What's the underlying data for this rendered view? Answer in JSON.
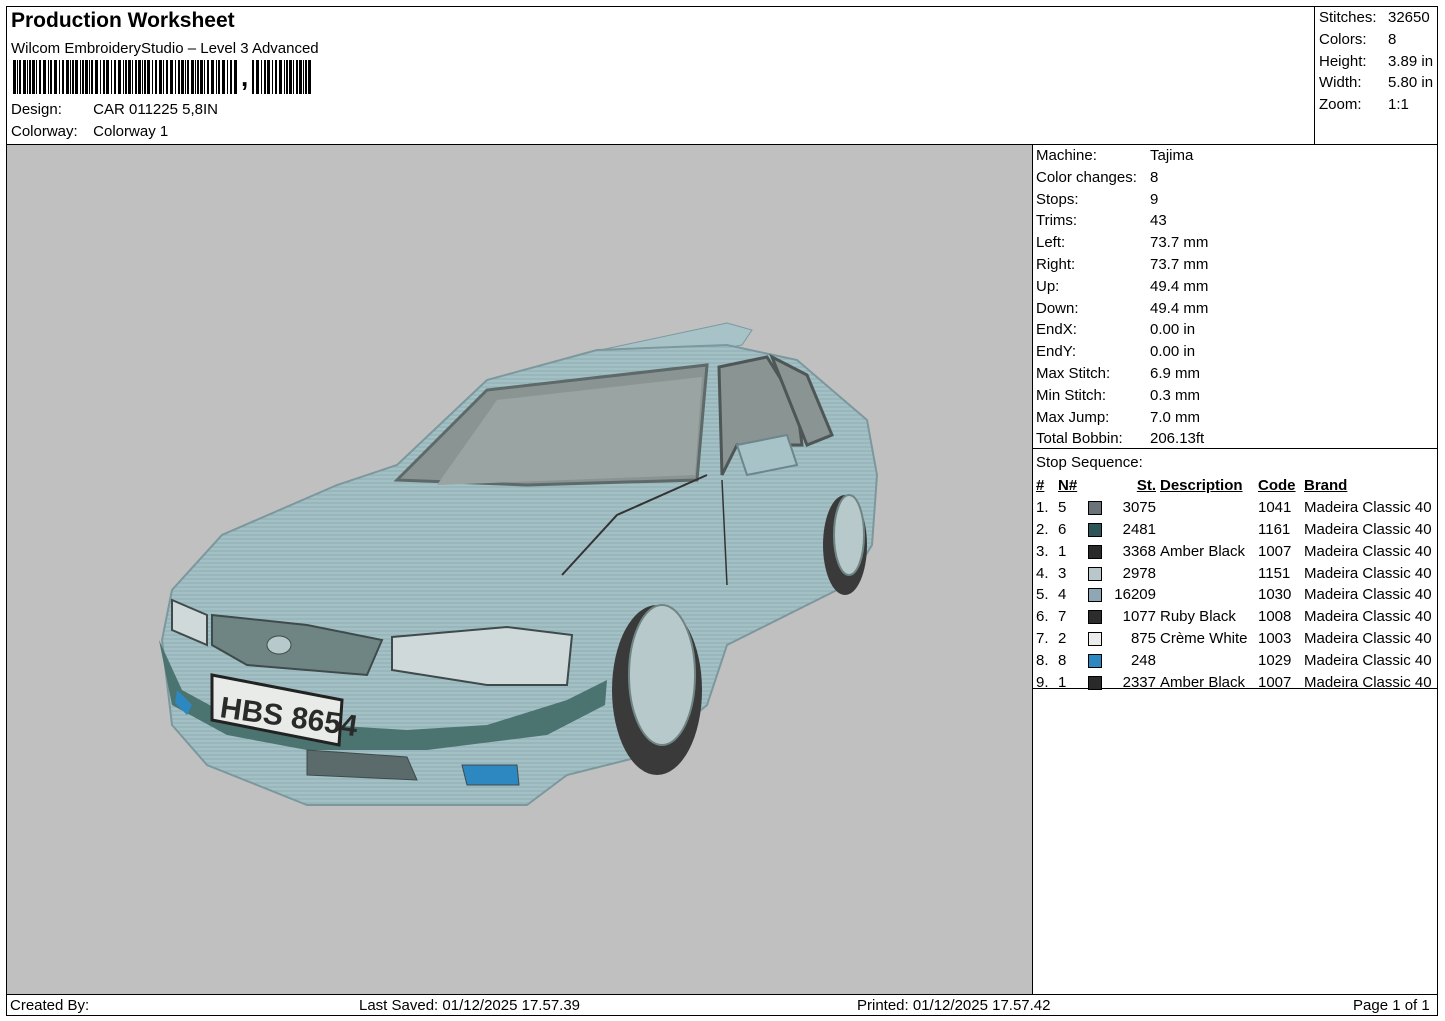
{
  "header": {
    "title": "Production Worksheet",
    "subtitle": "Wilcom EmbroideryStudio – Level 3 Advanced",
    "barcode_suffix": ",",
    "design_label": "Design:",
    "design_value": "CAR 011225 5,8IN",
    "colorway_label": "Colorway:",
    "colorway_value": "Colorway 1"
  },
  "summary": [
    {
      "label": "Stitches:",
      "value": "32650"
    },
    {
      "label": "Colors:",
      "value": "8"
    },
    {
      "label": "Height:",
      "value": "3.89 in"
    },
    {
      "label": "Width:",
      "value": "5.80 in"
    },
    {
      "label": "Zoom:",
      "value": "1:1"
    }
  ],
  "machine_info": [
    {
      "label": "Machine:",
      "value": "Tajima"
    },
    {
      "label": "Color changes:",
      "value": "8"
    },
    {
      "label": "Stops:",
      "value": "9"
    },
    {
      "label": "Trims:",
      "value": "43"
    },
    {
      "label": "Left:",
      "value": "73.7 mm"
    },
    {
      "label": "Right:",
      "value": "73.7 mm"
    },
    {
      "label": "Up:",
      "value": "49.4 mm"
    },
    {
      "label": "Down:",
      "value": "49.4 mm"
    },
    {
      "label": "EndX:",
      "value": "0.00 in"
    },
    {
      "label": "EndY:",
      "value": "0.00 in"
    },
    {
      "label": "Max Stitch:",
      "value": "6.9 mm"
    },
    {
      "label": "Min Stitch:",
      "value": "0.3 mm"
    },
    {
      "label": "Max Jump:",
      "value": "7.0 mm"
    },
    {
      "label": "Total Bobbin:",
      "value": "206.13ft"
    }
  ],
  "stop_sequence": {
    "title": "Stop Sequence:",
    "headers": {
      "idx": "#",
      "n": "N#",
      "st": "St.",
      "desc": "Description",
      "code": "Code",
      "brand": "Brand"
    },
    "rows": [
      {
        "idx": "1.",
        "n": "5",
        "color": "#6b7278",
        "st": "3075",
        "desc": "",
        "code": "1041",
        "brand": "Madeira Classic 40"
      },
      {
        "idx": "2.",
        "n": "6",
        "color": "#2e5558",
        "st": "2481",
        "desc": "",
        "code": "1161",
        "brand": "Madeira Classic 40"
      },
      {
        "idx": "3.",
        "n": "1",
        "color": "#2a2a2a",
        "st": "3368",
        "desc": "Amber Black",
        "code": "1007",
        "brand": "Madeira Classic 40"
      },
      {
        "idx": "4.",
        "n": "3",
        "color": "#b9c6ca",
        "st": "2978",
        "desc": "",
        "code": "1151",
        "brand": "Madeira Classic 40"
      },
      {
        "idx": "5.",
        "n": "4",
        "color": "#8fa7b5",
        "st": "16209",
        "desc": "",
        "code": "1030",
        "brand": "Madeira Classic 40"
      },
      {
        "idx": "6.",
        "n": "7",
        "color": "#2c2c2c",
        "st": "1077",
        "desc": "Ruby Black",
        "code": "1008",
        "brand": "Madeira Classic 40"
      },
      {
        "idx": "7.",
        "n": "2",
        "color": "#ececec",
        "st": "875",
        "desc": "Crème White",
        "code": "1003",
        "brand": "Madeira Classic 40"
      },
      {
        "idx": "8.",
        "n": "8",
        "color": "#2d87c0",
        "st": "248",
        "desc": "",
        "code": "1029",
        "brand": "Madeira Classic 40"
      },
      {
        "idx": "9.",
        "n": "1",
        "color": "#2a2a2a",
        "st": "2337",
        "desc": "Amber Black",
        "code": "1007",
        "brand": "Madeira Classic 40"
      }
    ]
  },
  "preview": {
    "plate_text": "HBS 8654",
    "colors": {
      "body": "#9fbcc1",
      "body_dark": "#7c989d",
      "glass": "#8a9493",
      "trim": "#4b7471",
      "tire": "#3a3a3a"
    }
  },
  "footer": {
    "created": "Created By:",
    "saved": "Last Saved: 01/12/2025 17.57.39",
    "printed": "Printed: 01/12/2025 17.57.42",
    "page": "Page 1 of 1"
  }
}
